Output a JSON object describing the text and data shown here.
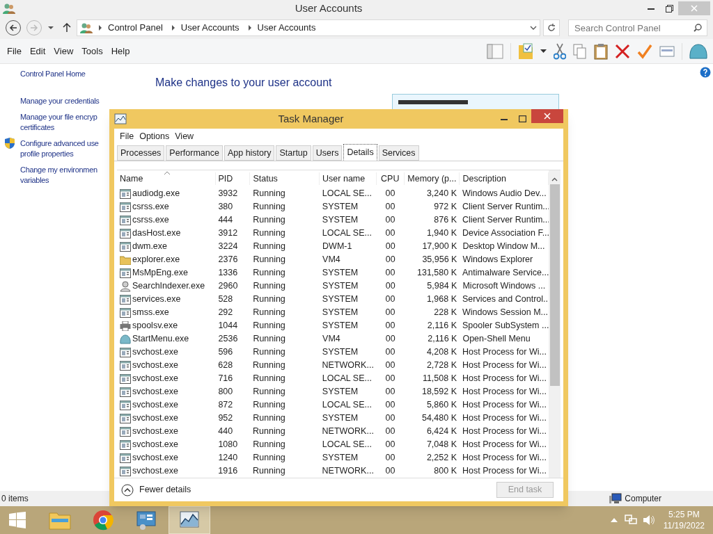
{
  "window": {
    "title": "User Accounts"
  },
  "address": {
    "crumbs": [
      "Control Panel",
      "User Accounts",
      "User Accounts"
    ],
    "search_placeholder": "Search Control Panel"
  },
  "menu": [
    "File",
    "Edit",
    "View",
    "Tools",
    "Help"
  ],
  "sidebar": {
    "items": [
      {
        "label": "Control Panel Home",
        "shield": false
      },
      {
        "label": "Manage your credentials",
        "shield": false
      },
      {
        "label": "Manage your file encryp\ncertificates",
        "shield": false
      },
      {
        "label": "Configure advanced use\nprofile properties",
        "shield": true
      },
      {
        "label": "Change my environmen\nvariables",
        "shield": false
      }
    ]
  },
  "content": {
    "heading": "Make changes to your user account"
  },
  "status_bar": {
    "items": "0 items",
    "zone": "Computer"
  },
  "task_manager": {
    "title": "Task Manager",
    "menu": [
      "File",
      "Options",
      "View"
    ],
    "tabs": [
      {
        "label": "Processes",
        "selected": false
      },
      {
        "label": "Performance",
        "selected": false
      },
      {
        "label": "App history",
        "selected": false
      },
      {
        "label": "Startup",
        "selected": false
      },
      {
        "label": "Users",
        "selected": false
      },
      {
        "label": "Details",
        "selected": true
      },
      {
        "label": "Services",
        "selected": false
      }
    ],
    "columns": [
      "Name",
      "PID",
      "Status",
      "User name",
      "CPU",
      "Memory (p...",
      "Description"
    ],
    "rows": [
      {
        "kind": "app",
        "name": "audiodg.exe",
        "pid": "3932",
        "status": "Running",
        "user": "LOCAL SE...",
        "cpu": "00",
        "memory": "3,240 K",
        "description": "Windows Audio Dev..."
      },
      {
        "kind": "app",
        "name": "csrss.exe",
        "pid": "380",
        "status": "Running",
        "user": "SYSTEM",
        "cpu": "00",
        "memory": "972 K",
        "description": "Client Server Runtim..."
      },
      {
        "kind": "app",
        "name": "csrss.exe",
        "pid": "444",
        "status": "Running",
        "user": "SYSTEM",
        "cpu": "00",
        "memory": "876 K",
        "description": "Client Server Runtim..."
      },
      {
        "kind": "app",
        "name": "dasHost.exe",
        "pid": "3912",
        "status": "Running",
        "user": "LOCAL SE...",
        "cpu": "00",
        "memory": "1,940 K",
        "description": "Device Association F..."
      },
      {
        "kind": "app",
        "name": "dwm.exe",
        "pid": "3224",
        "status": "Running",
        "user": "DWM-1",
        "cpu": "00",
        "memory": "17,900 K",
        "description": "Desktop Window M..."
      },
      {
        "kind": "folder",
        "name": "explorer.exe",
        "pid": "2376",
        "status": "Running",
        "user": "VM4",
        "cpu": "00",
        "memory": "35,956 K",
        "description": "Windows Explorer"
      },
      {
        "kind": "app",
        "name": "MsMpEng.exe",
        "pid": "1336",
        "status": "Running",
        "user": "SYSTEM",
        "cpu": "00",
        "memory": "131,580 K",
        "description": "Antimalware Service..."
      },
      {
        "kind": "search",
        "name": "SearchIndexer.exe",
        "pid": "2960",
        "status": "Running",
        "user": "SYSTEM",
        "cpu": "00",
        "memory": "5,984 K",
        "description": "Microsoft Windows ..."
      },
      {
        "kind": "app",
        "name": "services.exe",
        "pid": "528",
        "status": "Running",
        "user": "SYSTEM",
        "cpu": "00",
        "memory": "1,968 K",
        "description": "Services and Control..."
      },
      {
        "kind": "app",
        "name": "smss.exe",
        "pid": "292",
        "status": "Running",
        "user": "SYSTEM",
        "cpu": "00",
        "memory": "228 K",
        "description": "Windows Session M..."
      },
      {
        "kind": "printer",
        "name": "spoolsv.exe",
        "pid": "1044",
        "status": "Running",
        "user": "SYSTEM",
        "cpu": "00",
        "memory": "2,116 K",
        "description": "Spooler SubSystem ..."
      },
      {
        "kind": "shell",
        "name": "StartMenu.exe",
        "pid": "2536",
        "status": "Running",
        "user": "VM4",
        "cpu": "00",
        "memory": "2,116 K",
        "description": "Open-Shell Menu"
      },
      {
        "kind": "app",
        "name": "svchost.exe",
        "pid": "596",
        "status": "Running",
        "user": "SYSTEM",
        "cpu": "00",
        "memory": "4,208 K",
        "description": "Host Process for Wi..."
      },
      {
        "kind": "app",
        "name": "svchost.exe",
        "pid": "628",
        "status": "Running",
        "user": "NETWORK...",
        "cpu": "00",
        "memory": "2,728 K",
        "description": "Host Process for Wi..."
      },
      {
        "kind": "app",
        "name": "svchost.exe",
        "pid": "716",
        "status": "Running",
        "user": "LOCAL SE...",
        "cpu": "00",
        "memory": "11,508 K",
        "description": "Host Process for Wi..."
      },
      {
        "kind": "app",
        "name": "svchost.exe",
        "pid": "800",
        "status": "Running",
        "user": "SYSTEM",
        "cpu": "00",
        "memory": "18,592 K",
        "description": "Host Process for Wi..."
      },
      {
        "kind": "app",
        "name": "svchost.exe",
        "pid": "872",
        "status": "Running",
        "user": "LOCAL SE...",
        "cpu": "00",
        "memory": "5,860 K",
        "description": "Host Process for Wi..."
      },
      {
        "kind": "app",
        "name": "svchost.exe",
        "pid": "952",
        "status": "Running",
        "user": "SYSTEM",
        "cpu": "00",
        "memory": "54,480 K",
        "description": "Host Process for Wi..."
      },
      {
        "kind": "app",
        "name": "svchost.exe",
        "pid": "440",
        "status": "Running",
        "user": "NETWORK...",
        "cpu": "00",
        "memory": "6,424 K",
        "description": "Host Process for Wi..."
      },
      {
        "kind": "app",
        "name": "svchost.exe",
        "pid": "1080",
        "status": "Running",
        "user": "LOCAL SE...",
        "cpu": "00",
        "memory": "7,048 K",
        "description": "Host Process for Wi..."
      },
      {
        "kind": "app",
        "name": "svchost.exe",
        "pid": "1240",
        "status": "Running",
        "user": "SYSTEM",
        "cpu": "00",
        "memory": "2,252 K",
        "description": "Host Process for Wi..."
      },
      {
        "kind": "app",
        "name": "svchost.exe",
        "pid": "1916",
        "status": "Running",
        "user": "NETWORK...",
        "cpu": "00",
        "memory": "800 K",
        "description": "Host Process for Wi..."
      }
    ],
    "fewer_details": "Fewer details",
    "end_task": {
      "label": "End task",
      "disabled": true
    }
  },
  "taskbar": {
    "apps": [
      {
        "kind": "explorer",
        "selected": false
      },
      {
        "kind": "chrome",
        "selected": false
      },
      {
        "kind": "control",
        "selected": false
      },
      {
        "kind": "taskmgr",
        "selected": true
      }
    ],
    "time": "5:25 PM",
    "date": "11/19/2022"
  }
}
